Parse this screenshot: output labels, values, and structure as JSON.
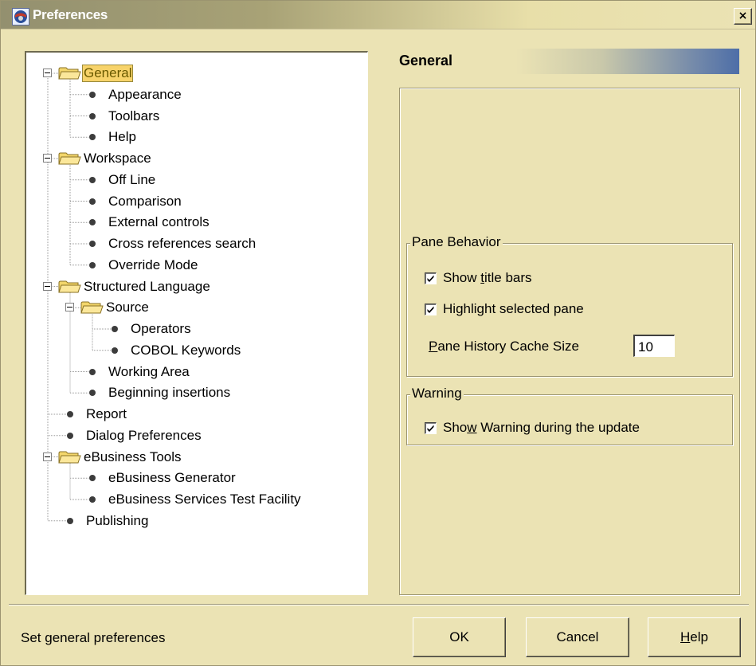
{
  "window": {
    "title": "Preferences",
    "close_label": "×"
  },
  "tree": {
    "items": [
      {
        "label": "General",
        "level": 1,
        "kind": "folder",
        "expanded": true,
        "selected": true
      },
      {
        "label": "Appearance",
        "level": 2,
        "kind": "leaf"
      },
      {
        "label": "Toolbars",
        "level": 2,
        "kind": "leaf"
      },
      {
        "label": "Help",
        "level": 2,
        "kind": "leaf"
      },
      {
        "label": "Workspace",
        "level": 1,
        "kind": "folder",
        "expanded": true
      },
      {
        "label": "Off Line",
        "level": 2,
        "kind": "leaf"
      },
      {
        "label": "Comparison",
        "level": 2,
        "kind": "leaf"
      },
      {
        "label": "External controls",
        "level": 2,
        "kind": "leaf"
      },
      {
        "label": "Cross references search",
        "level": 2,
        "kind": "leaf"
      },
      {
        "label": "Override Mode",
        "level": 2,
        "kind": "leaf"
      },
      {
        "label": "Structured Language",
        "level": 1,
        "kind": "folder",
        "expanded": true
      },
      {
        "label": "Source",
        "level": 2,
        "kind": "folder",
        "expanded": true
      },
      {
        "label": "Operators",
        "level": 3,
        "kind": "leaf"
      },
      {
        "label": "COBOL Keywords",
        "level": 3,
        "kind": "leaf"
      },
      {
        "label": "Working Area",
        "level": 2,
        "kind": "leaf"
      },
      {
        "label": "Beginning insertions",
        "level": 2,
        "kind": "leaf"
      },
      {
        "label": "Report",
        "level": 1,
        "kind": "leaf"
      },
      {
        "label": "Dialog Preferences",
        "level": 1,
        "kind": "leaf"
      },
      {
        "label": "eBusiness Tools",
        "level": 1,
        "kind": "folder",
        "expanded": true
      },
      {
        "label": "eBusiness Generator",
        "level": 2,
        "kind": "leaf"
      },
      {
        "label": "eBusiness Services Test Facility",
        "level": 2,
        "kind": "leaf"
      },
      {
        "label": "Publishing",
        "level": 1,
        "kind": "leaf"
      }
    ]
  },
  "content": {
    "title": "General",
    "pane_behavior": {
      "legend": "Pane Behavior",
      "show_title_bars": {
        "pre": "Show ",
        "mnemonic": "t",
        "post": "itle bars",
        "checked": true
      },
      "highlight_selected": {
        "pre": "Hi",
        "mnemonic": "g",
        "post": "hlight selected pane",
        "checked": true
      },
      "cache_size": {
        "pre": "",
        "mnemonic": "P",
        "post": "ane History Cache Size",
        "value": "10"
      }
    },
    "warning": {
      "legend": "Warning",
      "show_warning": {
        "pre": "Sho",
        "mnemonic": "w",
        "post": " Warning during the update",
        "checked": true
      }
    }
  },
  "status": {
    "text": "Set general preferences"
  },
  "buttons": {
    "ok": {
      "label": "OK"
    },
    "cancel": {
      "label": "Cancel"
    },
    "help": {
      "pre": "",
      "mnemonic": "H",
      "post": "elp"
    }
  }
}
